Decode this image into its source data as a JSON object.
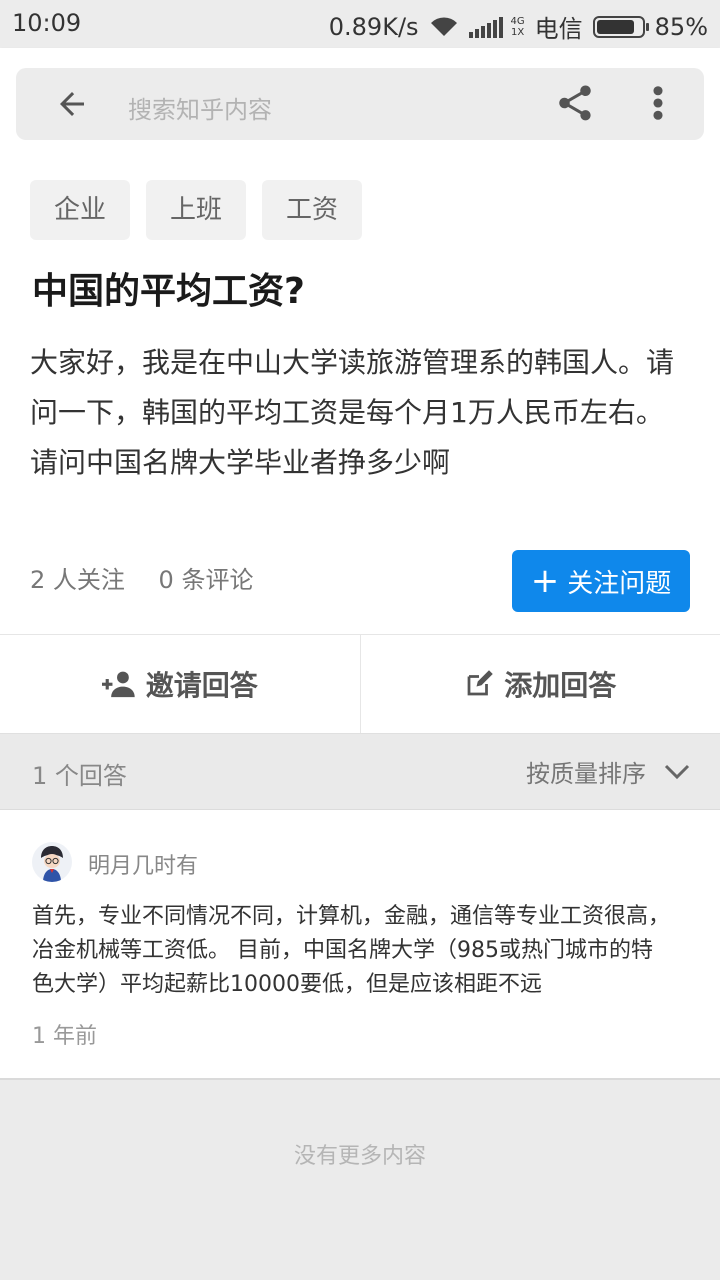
{
  "status_bar": {
    "time": "10:09",
    "speed": "0.89K/s",
    "network_top": "4G",
    "network_bottom": "1X",
    "carrier": "电信",
    "battery_text": "85%",
    "battery_level": 0.85
  },
  "search": {
    "placeholder": "搜索知乎内容"
  },
  "question": {
    "tags": [
      "企业",
      "上班",
      "工资"
    ],
    "title": "中国的平均工资?",
    "body_lines": [
      "大家好，我是在中山大学读旅游管理系的韩国人。请问一下，韩国的平均工资是每个月1万人民币左右。",
      "请问中国名牌大学毕业者挣多少啊"
    ],
    "followers": "2 人关注",
    "comments": "0 条评论",
    "follow_label": "关注问题"
  },
  "actions": {
    "invite_label": "邀请回答",
    "add_label": "添加回答"
  },
  "answers": {
    "count_label": "1 个回答",
    "sort_label": "按质量排序",
    "items": [
      {
        "author": "明月几时有",
        "excerpt": "首先，专业不同情况不同，计算机，金融，通信等专业工资很高，冶金机械等工资低。 目前，中国名牌大学（985或热门城市的特色大学）平均起薪比10000要低，但是应该相距不远",
        "time": "1 年前"
      }
    ]
  },
  "footer": {
    "no_more": "没有更多内容"
  },
  "colors": {
    "accent": "#0f88eb",
    "background": "#ebebeb"
  },
  "icons": [
    "back-arrow-icon",
    "share-icon",
    "more-vert-icon",
    "person-add-icon",
    "edit-icon",
    "chevron-down-icon",
    "wifi-icon",
    "signal-icon",
    "battery-icon"
  ]
}
